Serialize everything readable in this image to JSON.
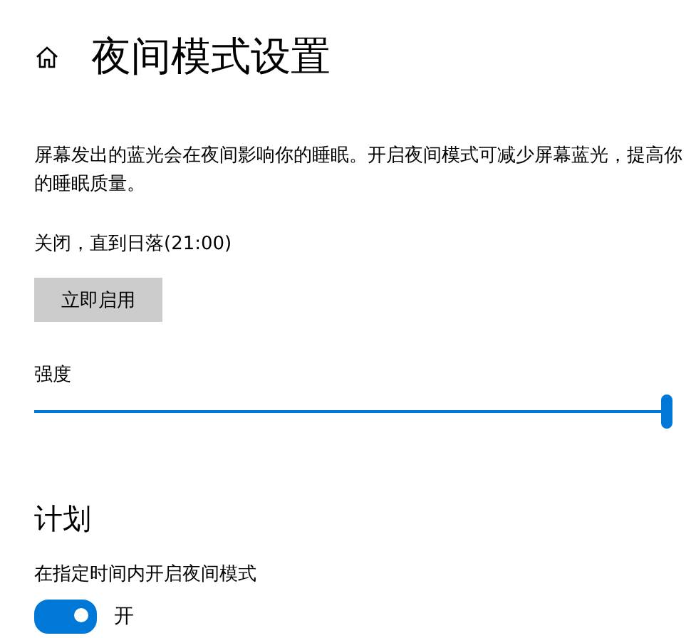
{
  "header": {
    "title": "夜间模式设置"
  },
  "description": "屏幕发出的蓝光会在夜间影响你的睡眠。开启夜间模式可减少屏幕蓝光，提高你的睡眠质量。",
  "status": "关闭，直到日落(21:00)",
  "enable_button": "立即启用",
  "strength": {
    "label": "强度",
    "level": 1.0
  },
  "schedule": {
    "heading": "计划",
    "label": "在指定时间内开启夜间模式",
    "toggle": {
      "on": true,
      "state_text": "开"
    }
  }
}
